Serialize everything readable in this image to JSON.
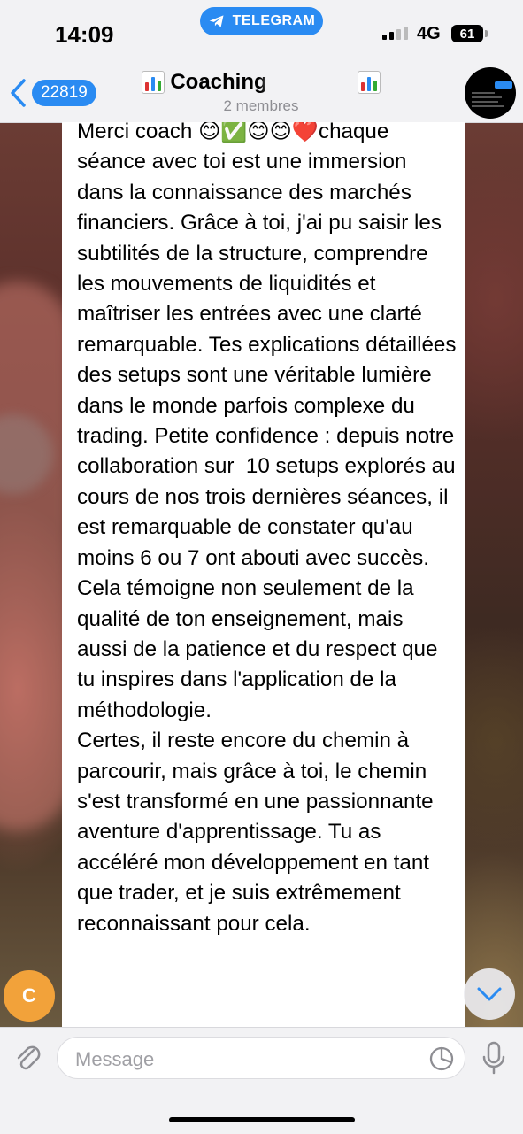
{
  "status_bar": {
    "time": "14:09",
    "app_pill": "TELEGRAM",
    "network": "4G",
    "battery": "61"
  },
  "header": {
    "unread_count": "22819",
    "title_prefix": "Coaching",
    "members": "2 membres"
  },
  "message": {
    "text": "Merci coach 😊✅😊😊❤️chaque séance avec toi est une immersion dans la connaissance des marchés financiers. Grâce à toi, j'ai pu saisir les subtilités de la structure, comprendre les mouvements de liquidités et maîtriser les entrées avec une clarté remarquable. Tes explications détaillées des setups sont une véritable lumière dans le monde parfois complexe du trading. Petite confidence : depuis notre collaboration sur  10 setups explorés au cours de nos trois dernières séances, il est remarquable de constater qu'au moins 6 ou 7 ont abouti avec succès. Cela témoigne non seulement de la qualité de ton enseignement, mais aussi de la patience et du respect que tu inspires dans l'application de la méthodologie.\nCertes, il reste encore du chemin à parcourir, mais grâce à toi, le chemin s'est transformé en une passionnante aventure d'apprentissage. Tu as accéléré mon développement en tant que trader, et je suis extrêmement reconnaissant pour cela."
  },
  "sender_avatar_letter": "C",
  "input": {
    "placeholder": "Message"
  },
  "colors": {
    "accent": "#2a8bf2",
    "avatar_orange": "#f2a23a"
  }
}
